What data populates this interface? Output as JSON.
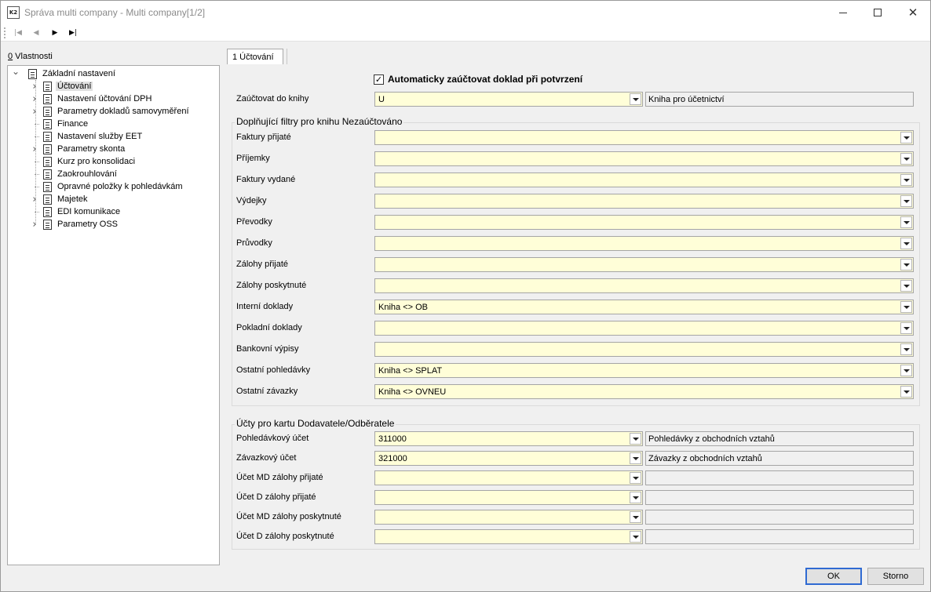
{
  "window": {
    "title": "Správa multi company - Multi company[1/2]",
    "icon_text": "K2"
  },
  "nav": {
    "first": "|◀",
    "prev": "◀",
    "next": "▶",
    "last": "▶|"
  },
  "left_panel": {
    "label_hotkey": "0",
    "label_rest": " Vlastnosti",
    "tree_root": "Základní nastavení",
    "tree_items": [
      {
        "label": "Účtování",
        "expandable": true,
        "selected": true
      },
      {
        "label": "Nastavení účtování DPH",
        "expandable": true,
        "selected": false
      },
      {
        "label": "Parametry dokladů samovyměření",
        "expandable": true,
        "selected": false
      },
      {
        "label": "Finance",
        "expandable": false,
        "selected": false
      },
      {
        "label": "Nastavení služby EET",
        "expandable": false,
        "selected": false
      },
      {
        "label": "Parametry skonta",
        "expandable": true,
        "selected": false
      },
      {
        "label": "Kurz pro konsolidaci",
        "expandable": false,
        "selected": false
      },
      {
        "label": "Zaokrouhlování",
        "expandable": false,
        "selected": false
      },
      {
        "label": "Opravné položky k pohledávkám",
        "expandable": false,
        "selected": false
      },
      {
        "label": "Majetek",
        "expandable": true,
        "selected": false
      },
      {
        "label": "EDI komunikace",
        "expandable": false,
        "selected": false
      },
      {
        "label": "Parametry OSS",
        "expandable": true,
        "selected": false
      }
    ]
  },
  "tab": {
    "label": "1 Účtování"
  },
  "form": {
    "auto_post_label": "Automaticky zaúčtovat doklad při potvrzení",
    "auto_post_checked": true,
    "check_glyph": "✓",
    "book_label": "Zaúčtovat do knihy",
    "book_value": "U",
    "book_description": "Kniha pro účetnictví"
  },
  "filters": {
    "title": "Doplňující filtry pro knihu Nezaúčtováno",
    "rows": [
      {
        "label": "Faktury přijaté",
        "value": ""
      },
      {
        "label": "Příjemky",
        "value": ""
      },
      {
        "label": "Faktury vydané",
        "value": ""
      },
      {
        "label": "Výdejky",
        "value": ""
      },
      {
        "label": "Převodky",
        "value": ""
      },
      {
        "label": "Průvodky",
        "value": ""
      },
      {
        "label": "Zálohy přijaté",
        "value": ""
      },
      {
        "label": "Zálohy poskytnuté",
        "value": ""
      },
      {
        "label": "Interní doklady",
        "value": "Kniha <> OB"
      },
      {
        "label": "Pokladní doklady",
        "value": ""
      },
      {
        "label": "Bankovní výpisy",
        "value": ""
      },
      {
        "label": "Ostatní pohledávky",
        "value": "Kniha <> SPLAT"
      },
      {
        "label": "Ostatní závazky",
        "value": "Kniha <> OVNEU"
      }
    ]
  },
  "accounts": {
    "title": "Účty pro kartu Dodavatele/Odběratele",
    "rows": [
      {
        "label": "Pohledávkový účet",
        "value": "311000",
        "description": "Pohledávky z obchodních vztahů"
      },
      {
        "label": "Závazkový účet",
        "value": "321000",
        "description": "Závazky z obchodních vztahů"
      },
      {
        "label": "Účet MD zálohy přijaté",
        "value": "",
        "description": ""
      },
      {
        "label": "Účet D zálohy přijaté",
        "value": "",
        "description": ""
      },
      {
        "label": "Účet MD zálohy poskytnuté",
        "value": "",
        "description": ""
      },
      {
        "label": "Účet D zálohy poskytnuté",
        "value": "",
        "description": ""
      }
    ]
  },
  "buttons": {
    "ok": "OK",
    "cancel": "Storno"
  }
}
